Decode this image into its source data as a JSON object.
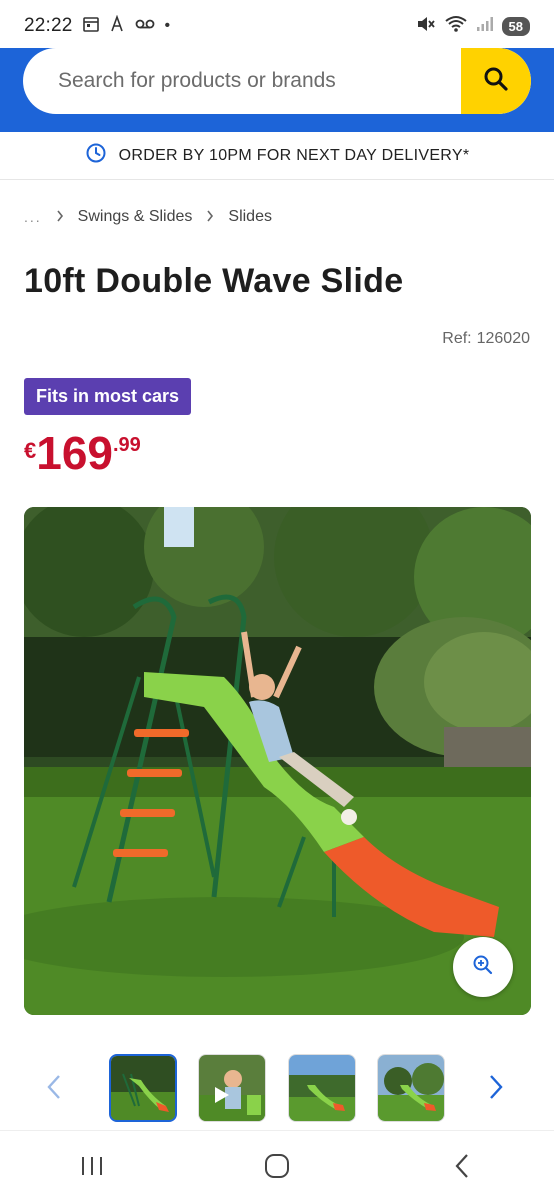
{
  "status_bar": {
    "time": "22:22",
    "battery": "58",
    "dot": "•"
  },
  "search": {
    "placeholder": "Search for products or brands"
  },
  "delivery": {
    "text": "ORDER BY 10PM FOR NEXT DAY DELIVERY*"
  },
  "breadcrumb": {
    "ellipsis": "...",
    "items": [
      "Swings & Slides",
      "Slides"
    ]
  },
  "product": {
    "title": "10ft Double Wave Slide",
    "ref_label": "Ref:",
    "ref_value": "126020",
    "badge": "Fits in most cars",
    "price_currency": "€",
    "price_main": "169",
    "price_cents": ".99"
  },
  "colors": {
    "brand_blue": "#1d64d8",
    "search_yellow": "#ffd200",
    "badge_purple": "#5b3fb0",
    "price_red": "#c8102e"
  },
  "thumbnails": {
    "count": 4,
    "active_index": 0
  }
}
